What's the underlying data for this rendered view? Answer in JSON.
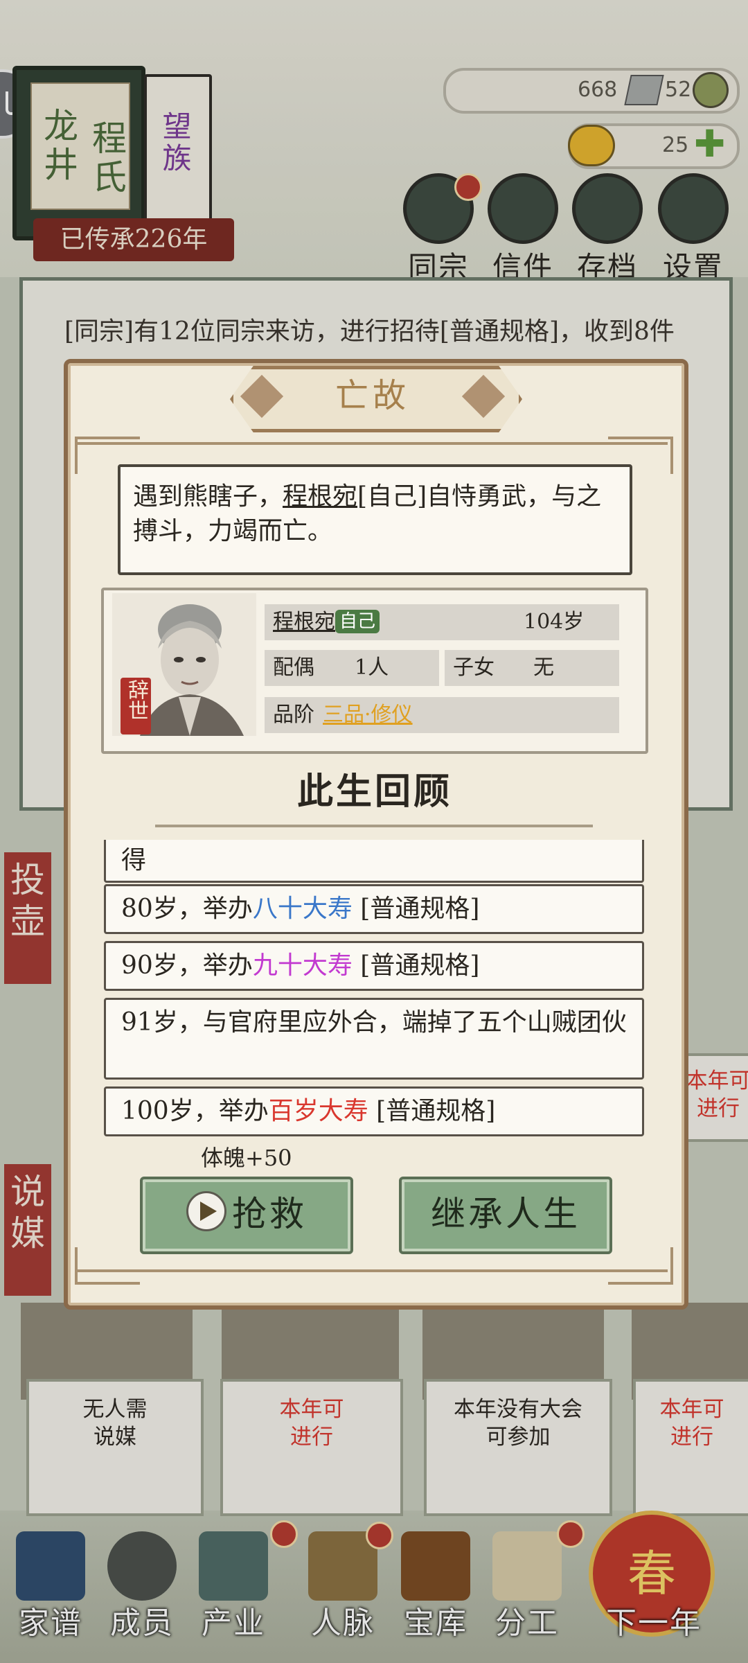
{
  "clan": {
    "name_col1": "龙井",
    "name_col2": "程氏",
    "rank": "望族",
    "inherited": "已传承226年"
  },
  "currency": {
    "silver": "668",
    "coins": "52",
    "gold": "25"
  },
  "top_icons": [
    "同宗",
    "信件",
    "存档",
    "设置"
  ],
  "log": {
    "line1": "[同宗]有12位同宗来访，进行招待[普通规格]，收到8件"
  },
  "side_tabs": [
    "投壶",
    "说媒"
  ],
  "tiles": [
    {
      "line1": "无人需",
      "line2": "说媒"
    },
    {
      "line1": "本年可",
      "line2": "进行"
    },
    {
      "line1": "本年没有大会",
      "line2": "可参加"
    },
    {
      "line1": "本年可",
      "line2": "进行"
    }
  ],
  "right_tile": {
    "line1": "本年可",
    "line2": "进行"
  },
  "bottom_nav": [
    "家谱",
    "成员",
    "产业",
    "人脉",
    "宝库",
    "分工",
    "下一年"
  ],
  "spring_char": "春",
  "modal": {
    "title": "亡故",
    "desc_pre": "遇到熊瞎子，",
    "desc_name": "程根宛",
    "desc_post": "[自己]自恃勇武，与之搏斗，力竭而亡。",
    "person": {
      "name": "程根宛",
      "self_badge": "自己",
      "age": "104岁",
      "spouse_label": "配偶",
      "spouse_value": "1人",
      "children_label": "子女",
      "children_value": "无",
      "rank_label": "品阶",
      "rank_value": "三品·修仪",
      "status_seal": "辞世"
    },
    "review_title": "此生回顾",
    "entries": [
      {
        "text": "得"
      },
      {
        "pre": "80岁，举办",
        "hl": "八十大寿",
        "post": " [普通规格]"
      },
      {
        "pre": "90岁，举办",
        "hl": "九十大寿",
        "post": " [普通规格]"
      },
      {
        "text": "91岁，与官府里应外合，端掉了五个山贼团伙"
      },
      {
        "pre": "100岁，举办",
        "hl": "百岁大寿",
        "post": " [普通规格]"
      }
    ],
    "bonus": "体魄+50",
    "rescue_label": "抢救",
    "inherit_label": "继承人生"
  },
  "colors": {
    "accent_green": "#86a885",
    "seal_red": "#b0312a",
    "highlight_blue": "#3a77c9",
    "highlight_purple": "#c23ad0",
    "highlight_red": "#d9372e",
    "rank_gold": "#e0a020"
  }
}
